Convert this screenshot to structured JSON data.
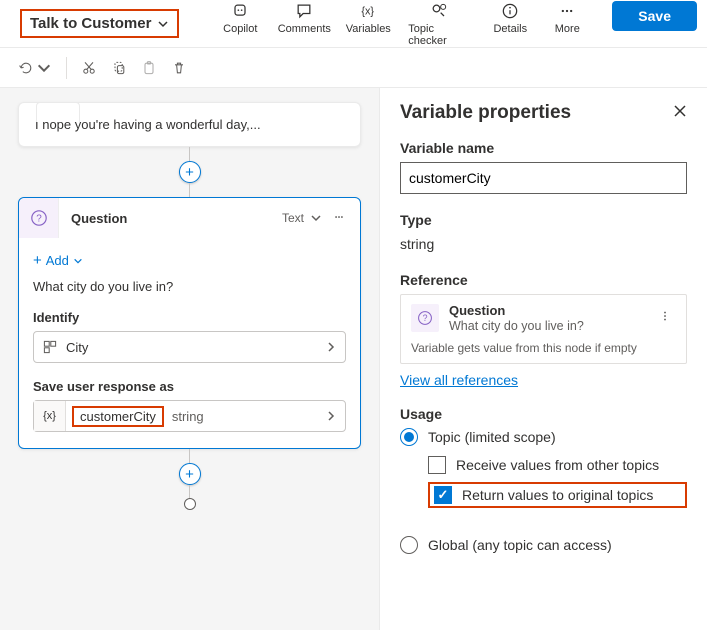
{
  "toolbar": {
    "topic_name": "Talk to Customer",
    "actions": {
      "copilot": "Copilot",
      "comments": "Comments",
      "variables": "Variables",
      "topic_checker": "Topic checker",
      "details": "Details",
      "more": "More"
    },
    "save_label": "Save"
  },
  "canvas": {
    "message_preview": "I hope you're having a wonderful day,...",
    "question_node": {
      "title": "Question",
      "output_type": "Text",
      "add_label": "Add",
      "question_text": "What city do you live in?",
      "identify_label": "Identify",
      "identify_value": "City",
      "save_label": "Save user response as",
      "variable_name": "customerCity",
      "variable_type": "string"
    }
  },
  "panel": {
    "title": "Variable properties",
    "name_label": "Variable name",
    "name_value": "customerCity",
    "type_label": "Type",
    "type_value": "string",
    "reference_label": "Reference",
    "reference": {
      "kind": "Question",
      "text": "What city do you live in?",
      "note": "Variable gets value from this node if empty"
    },
    "view_all_link": "View all references",
    "usage_label": "Usage",
    "usage": {
      "topic_option": "Topic (limited scope)",
      "receive_option": "Receive values from other topics",
      "return_option": "Return values to original topics",
      "global_option": "Global (any topic can access)"
    }
  }
}
